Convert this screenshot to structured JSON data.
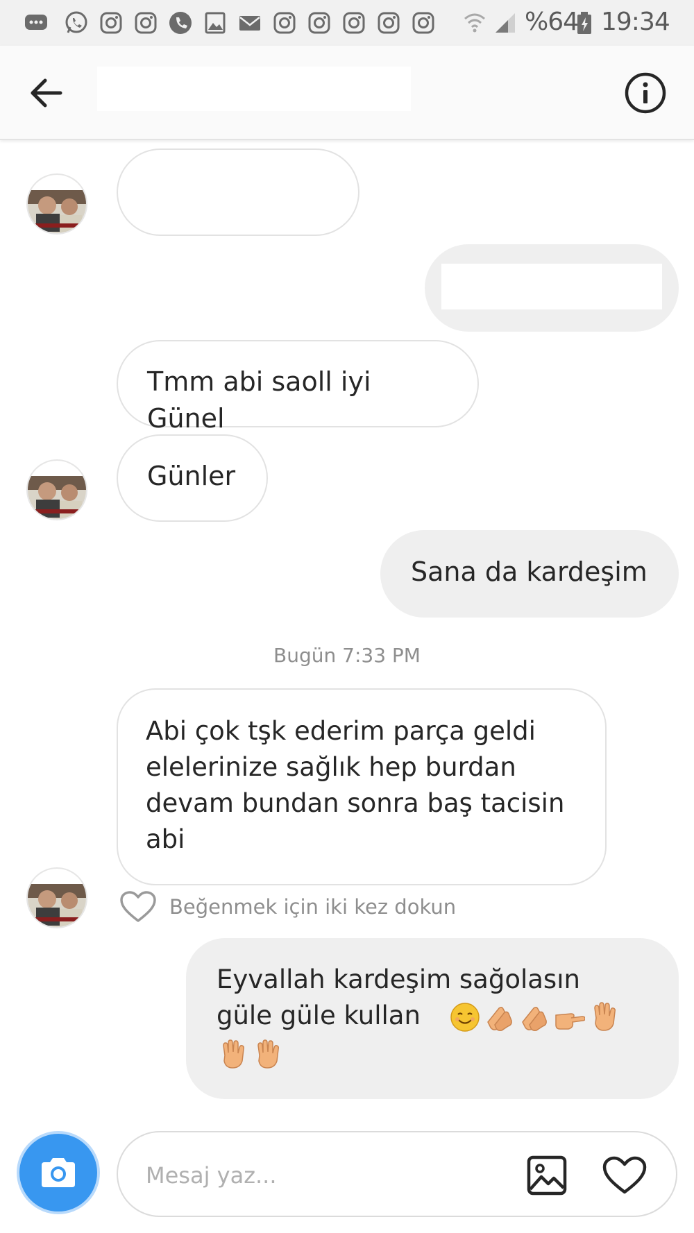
{
  "status_bar": {
    "icons": [
      "messages-icon",
      "whatsapp-icon",
      "instagram-icon",
      "instagram-icon",
      "phone-icon",
      "gallery-icon",
      "mail-icon",
      "instagram-icon",
      "instagram-icon",
      "instagram-icon",
      "instagram-icon",
      "instagram-icon"
    ],
    "battery": "%64",
    "time": "19:34"
  },
  "header": {
    "title": ""
  },
  "messages": [
    {
      "side": "in",
      "text": ""
    },
    {
      "side": "out",
      "text": ""
    },
    {
      "side": "in",
      "text": "Tmm abi saoll iyi Günel"
    },
    {
      "side": "in",
      "text": "Günler"
    },
    {
      "side": "out",
      "text": "Sana da kardeşim"
    },
    {
      "side": "in",
      "text": "Abi çok tşk ederim parça geldi elelerinize sağlık hep burdan devam bundan sonra baş tacisin abi"
    },
    {
      "side": "out",
      "text_line1": "Eyvallah kardeşim sağolasın",
      "text_line2": "güle güle kullan"
    }
  ],
  "timestamp": "Bugün 7:33 PM",
  "like_hint": "Beğenmek için iki kez dokun",
  "composer": {
    "placeholder": "Mesaj yaz..."
  },
  "colors": {
    "accent": "#3897f0",
    "incoming_border": "#e2e2e2",
    "outgoing_bg": "#efefef",
    "muted_text": "#8e8e8e"
  },
  "emojis": [
    "smiling-face-icon",
    "clapping-hands-icon",
    "clapping-hands-icon",
    "pointing-hand-icon",
    "raised-hand-icon",
    "raised-hand-icon",
    "raised-hand-icon"
  ]
}
